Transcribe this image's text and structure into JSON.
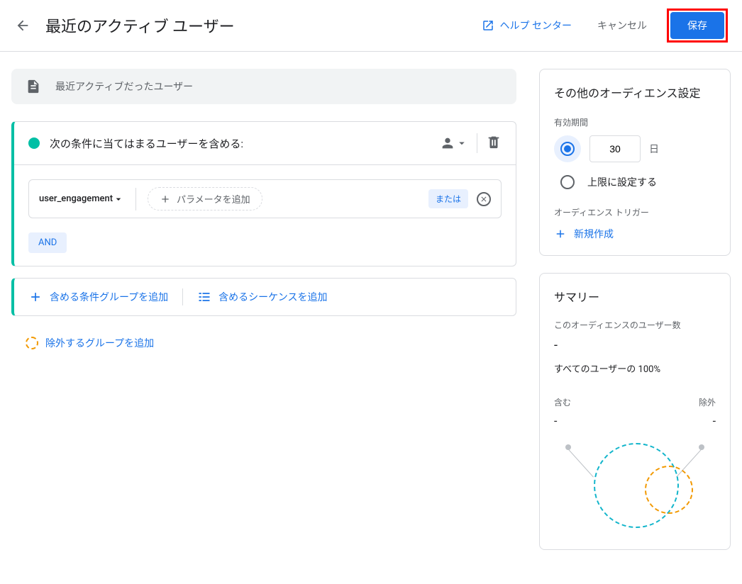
{
  "header": {
    "title": "最近のアクティブ ユーザー",
    "help_link": "ヘルプ センター",
    "cancel": "キャンセル",
    "save": "保存"
  },
  "description": "最近アクティブだったユーザー",
  "condition": {
    "include_title": "次の条件に当てはまるユーザーを含める:",
    "event": "user_engagement",
    "add_param": "パラメータを追加",
    "or": "または",
    "and": "AND"
  },
  "add_actions": {
    "add_group": "含める条件グループを追加",
    "add_sequence": "含めるシーケンスを追加",
    "add_exclude": "除外するグループを追加"
  },
  "settings": {
    "panel_title": "その他のオーディエンス設定",
    "duration_label": "有効期間",
    "duration_value": "30",
    "duration_unit": "日",
    "max_option": "上限に設定する",
    "trigger_label": "オーディエンス トリガー",
    "add_trigger": "新規作成"
  },
  "summary": {
    "title": "サマリー",
    "users_label": "このオーディエンスのユーザー数",
    "users_value": "-",
    "percent": "すべてのユーザーの 100%",
    "include_label": "含む",
    "include_value": "-",
    "exclude_label": "除外",
    "exclude_value": "-"
  }
}
